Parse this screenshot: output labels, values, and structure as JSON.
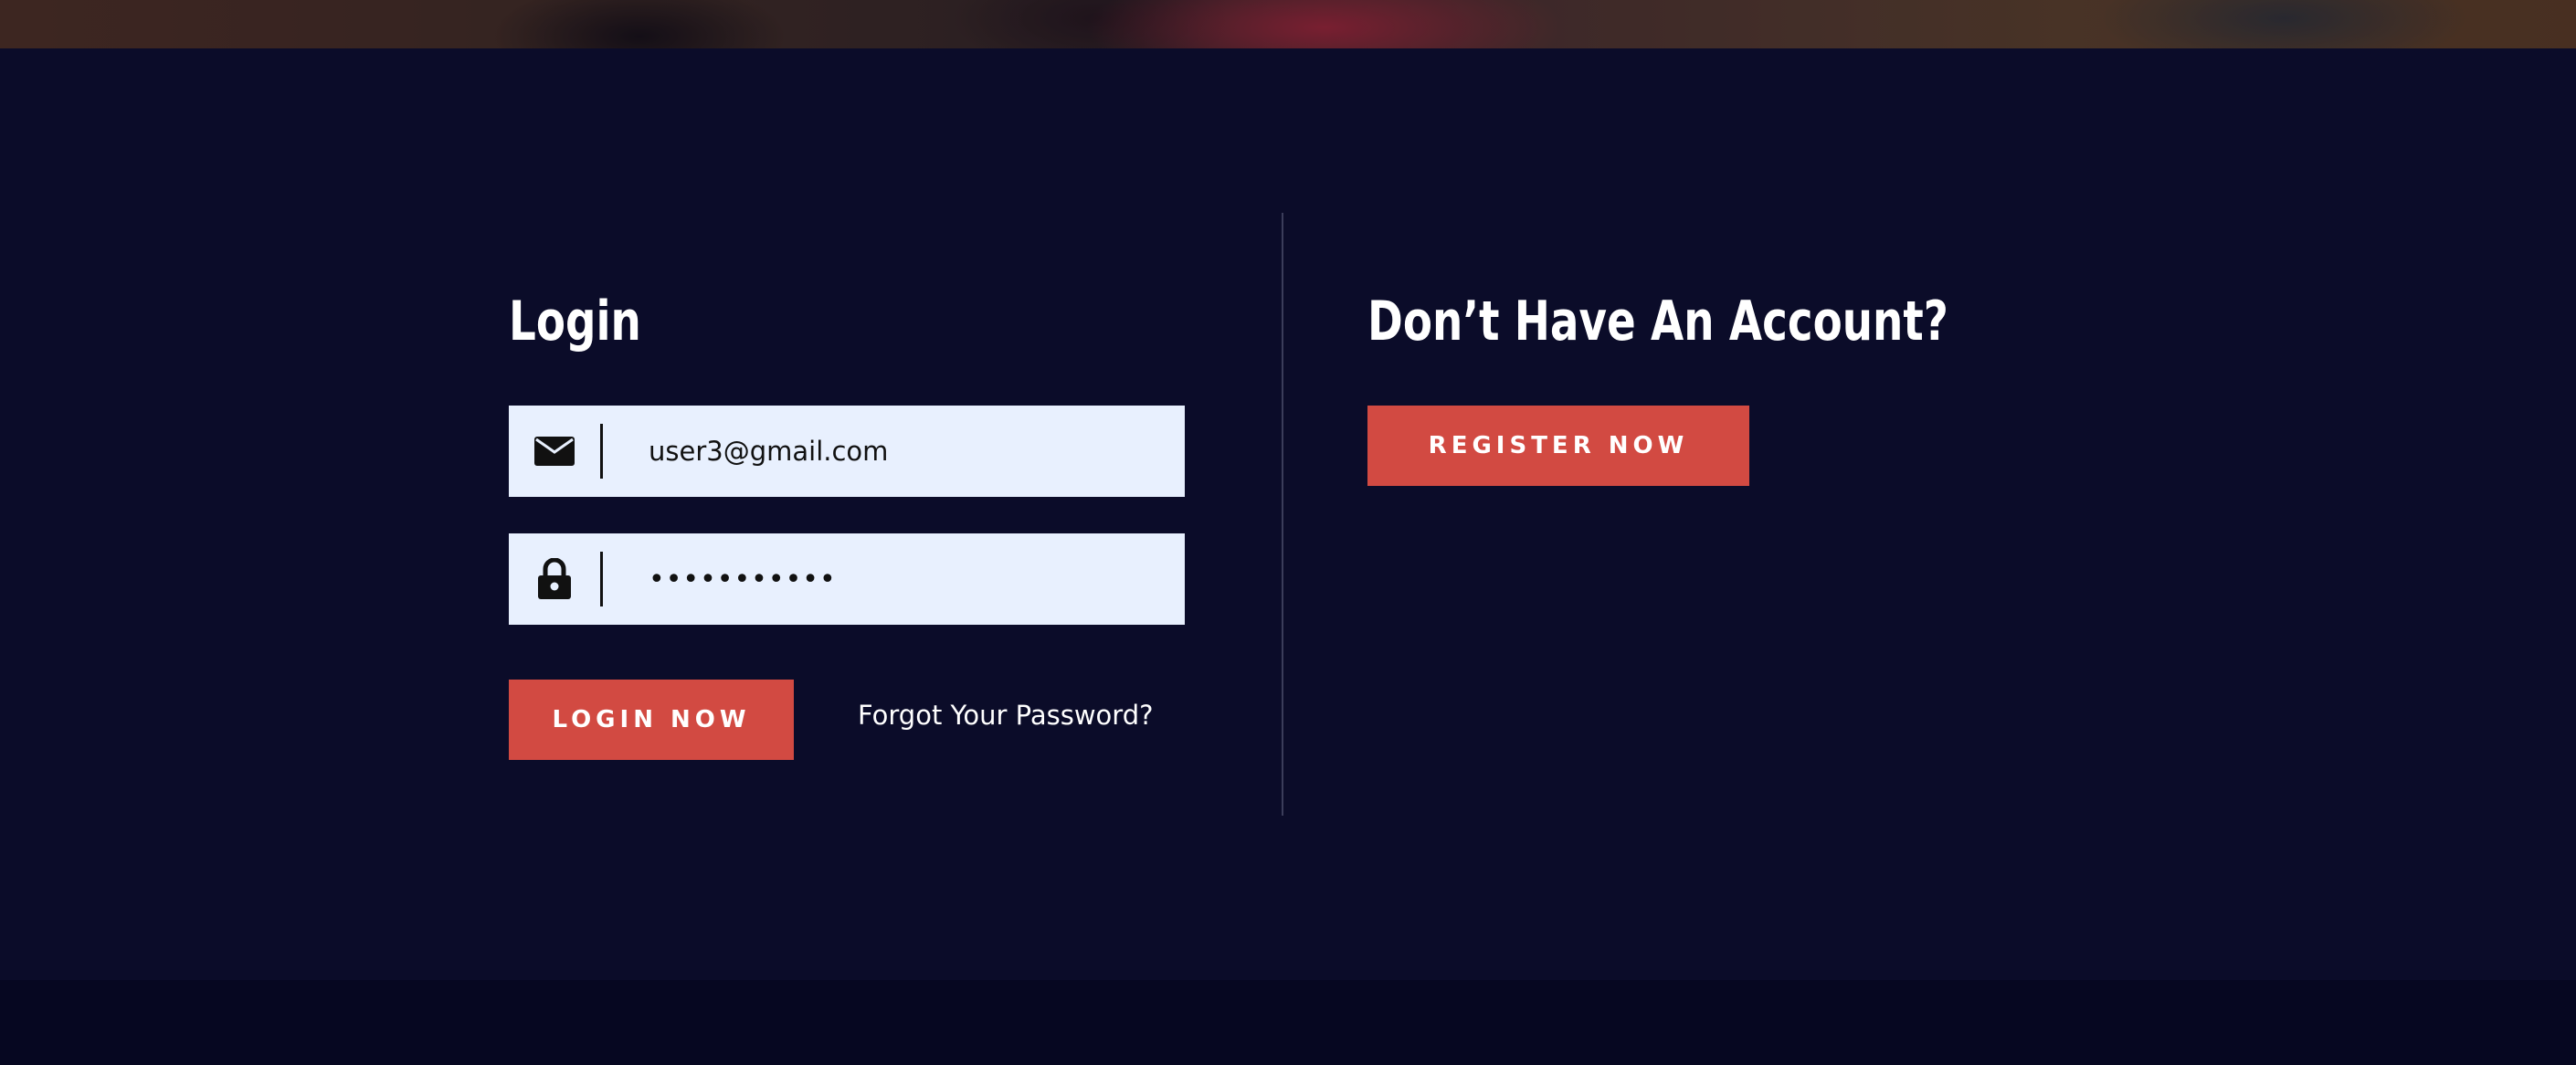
{
  "login": {
    "title": "Login",
    "email_icon": "envelope-icon",
    "email_value": "user3@gmail.com",
    "password_icon": "lock-icon",
    "password_value": "•••••••••••",
    "login_button": "LOGIN NOW",
    "forgot_link": "Forgot Your Password?"
  },
  "register": {
    "title": "Don’t Have An Account?",
    "register_button": "REGISTER NOW"
  },
  "colors": {
    "background": "#0b0c29",
    "footer": "#060721",
    "accent": "#d24a42",
    "input_bg": "#e8f0fe",
    "divider": "#3b3d5a"
  }
}
